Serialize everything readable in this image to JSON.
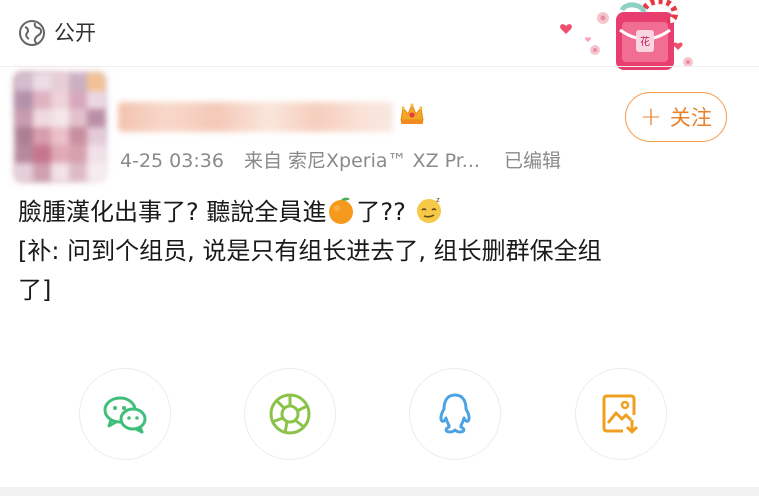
{
  "header": {
    "visibility_label": "公开",
    "visibility_icon": "globe-icon",
    "decoration_icon": "gift-decoration-icon"
  },
  "post": {
    "timestamp": "4-25 03:36",
    "source": "来自 索尼Xperia™ XZ Pr...",
    "edited_label": "已编辑",
    "follow_label": "关注",
    "author_badge_icon": "crown-icon",
    "line1_part1": "臉腫漢化出事了? 聽說全員進",
    "line1_part2": "了??",
    "line2": "[补: 问到个组员, 说是只有组长进去了, 组长删群保全组",
    "line3": "了]"
  },
  "share": {
    "wechat_icon": "wechat-icon",
    "moments_icon": "moments-icon",
    "qq_icon": "qq-icon",
    "save_image_icon": "save-image-icon"
  },
  "colors": {
    "accent": "#f29a4a",
    "wechat": "#3fbf7a",
    "moments": "#8bc34a",
    "qq": "#4ba3e3",
    "save": "#f0a020"
  }
}
